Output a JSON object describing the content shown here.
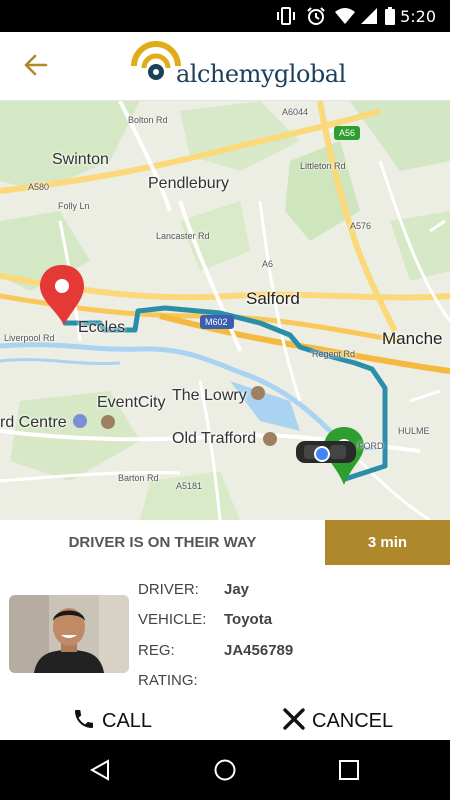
{
  "status_bar": {
    "time": "5:20"
  },
  "app": {
    "logo_text": "alchemyglobal"
  },
  "map": {
    "places": {
      "swinton": "Swinton",
      "pendlebury": "Pendlebury",
      "salford": "Salford",
      "manchester": "Manche",
      "eccles": "Eccles",
      "eventcity": "EventCity",
      "the_lowry": "The Lowry",
      "old_trafford": "Old Trafford",
      "trafford_centre": "rd Centre",
      "hulme": "HULME",
      "ford": "FORD"
    },
    "roads": {
      "a56": "A56",
      "a6044": "A6044",
      "a580": "A580",
      "a576": "A576",
      "a6": "A6",
      "m602": "M602",
      "bolton_rd": "Bolton Rd",
      "folly_ln": "Folly Ln",
      "lancaster_rd": "Lancaster Rd",
      "littleton_rd": "Littleton Rd",
      "liverpool_rd": "Liverpool Rd",
      "regent_rd": "Regent Rd",
      "barton_rd": "Barton Rd",
      "a5181": "A5181"
    }
  },
  "trip": {
    "status": "DRIVER IS ON THEIR WAY",
    "eta": "3 min"
  },
  "driver": {
    "driver_label": "DRIVER:",
    "driver_name": "Jay",
    "vehicle_label": "VEHICLE:",
    "vehicle": "Toyota",
    "reg_label": "REG:",
    "reg": "JA456789",
    "rating_label": "RATING:"
  },
  "actions": {
    "call_label": "CALL",
    "cancel_label": "CANCEL"
  },
  "colors": {
    "accent": "#b0882c",
    "route": "#2a8ea8",
    "pickup_pin": "#e53935",
    "dropoff_pin": "#2e9e2e"
  }
}
